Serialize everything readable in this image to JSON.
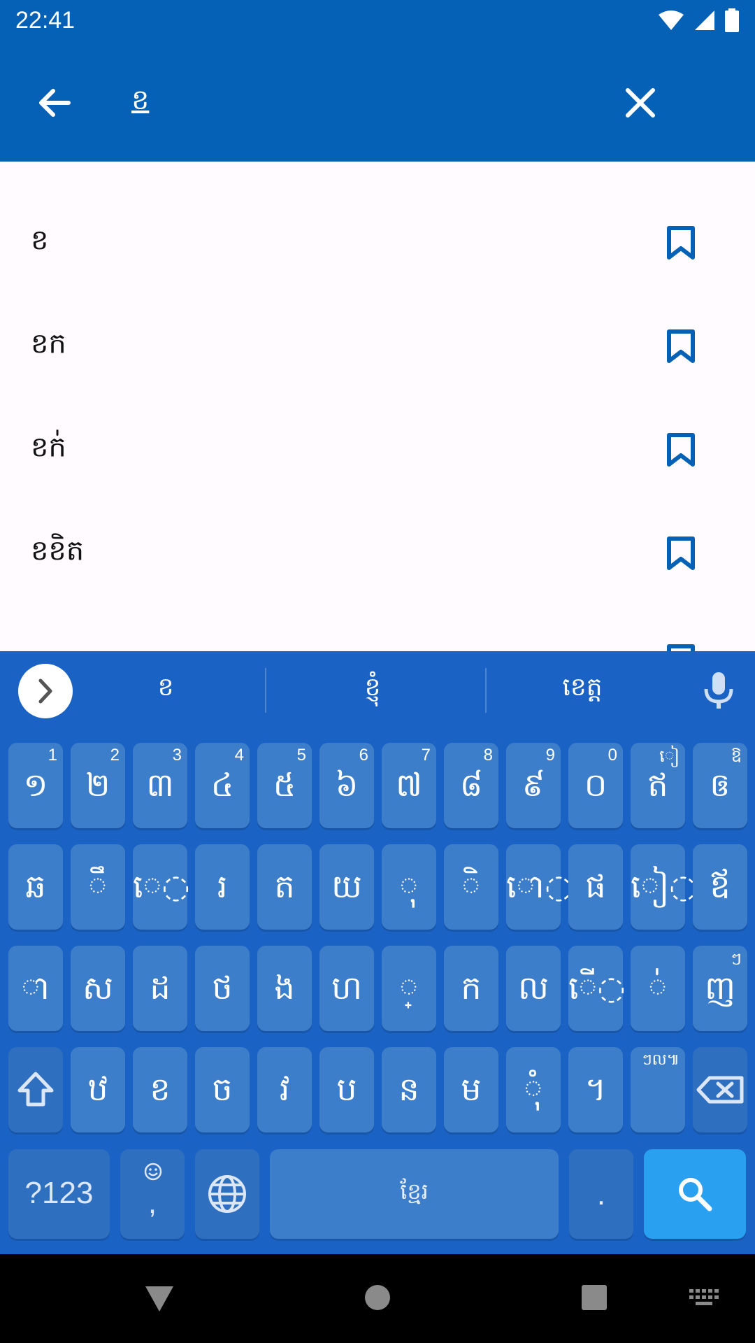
{
  "status_bar": {
    "time": "22:41",
    "icons": [
      "wifi-icon",
      "cellular-signal-icon",
      "battery-icon"
    ]
  },
  "app_bar": {
    "query": "ខ",
    "icons": [
      "back-arrow-icon",
      "clear-icon"
    ]
  },
  "results": [
    {
      "word": "ខ"
    },
    {
      "word": "ខក"
    },
    {
      "word": "ខក់"
    },
    {
      "word": "ខខិត"
    }
  ],
  "keyboard": {
    "suggestions": [
      "ខ",
      "ខ្ញុំ",
      "ខេត្ត"
    ],
    "row1": [
      {
        "main": "១",
        "hint": "1"
      },
      {
        "main": "២",
        "hint": "2"
      },
      {
        "main": "៣",
        "hint": "3"
      },
      {
        "main": "៤",
        "hint": "4"
      },
      {
        "main": "៥",
        "hint": "5"
      },
      {
        "main": "៦",
        "hint": "6"
      },
      {
        "main": "៧",
        "hint": "7"
      },
      {
        "main": "៨",
        "hint": "8"
      },
      {
        "main": "៩",
        "hint": "9"
      },
      {
        "main": "០",
        "hint": "0"
      },
      {
        "main": "ឥ",
        "hint": "ៀ"
      },
      {
        "main": "ឲ",
        "hint": "ឱ"
      }
    ],
    "row2": [
      {
        "main": "ឆ",
        "hint": ""
      },
      {
        "main": "◌ឹ",
        "hint": ""
      },
      {
        "main": "េ◌",
        "hint": ""
      },
      {
        "main": "រ",
        "hint": ""
      },
      {
        "main": "ត",
        "hint": ""
      },
      {
        "main": "យ",
        "hint": ""
      },
      {
        "main": "◌ុ",
        "hint": ""
      },
      {
        "main": "◌ិ",
        "hint": ""
      },
      {
        "main": "ោ◌",
        "hint": ""
      },
      {
        "main": "ផ",
        "hint": ""
      },
      {
        "main": "ៀ◌",
        "hint": ""
      },
      {
        "main": "ឪ",
        "hint": ""
      }
    ],
    "row3": [
      {
        "main": "◌ា",
        "hint": ""
      },
      {
        "main": "ស",
        "hint": ""
      },
      {
        "main": "ដ",
        "hint": ""
      },
      {
        "main": "ថ",
        "hint": ""
      },
      {
        "main": "ង",
        "hint": ""
      },
      {
        "main": "ហ",
        "hint": ""
      },
      {
        "main": "◌្",
        "hint": ""
      },
      {
        "main": "ក",
        "hint": ""
      },
      {
        "main": "ល",
        "hint": ""
      },
      {
        "main": "ើ◌",
        "hint": ""
      },
      {
        "main": "◌់",
        "hint": ""
      },
      {
        "main": "ញ",
        "hint": "ៗ"
      }
    ],
    "row4": [
      {
        "main": "ឋ",
        "hint": ""
      },
      {
        "main": "ខ",
        "hint": ""
      },
      {
        "main": "ច",
        "hint": ""
      },
      {
        "main": "វ",
        "hint": ""
      },
      {
        "main": "ប",
        "hint": ""
      },
      {
        "main": "ន",
        "hint": ""
      },
      {
        "main": "ម",
        "hint": ""
      },
      {
        "main": "◌ុំ",
        "hint": ""
      },
      {
        "main": "។",
        "hint": ""
      },
      {
        "main": "",
        "hint": "ៗល៕"
      }
    ],
    "symbols_label": "?123",
    "comma_label": ",",
    "space_label": "ខ្មែរ",
    "period_label": "."
  },
  "colors": {
    "app_bar": "#0561b5",
    "keyboard_bg": "#1a62c4",
    "key": "#3d7ecb",
    "search_key": "#2aa0f0"
  }
}
